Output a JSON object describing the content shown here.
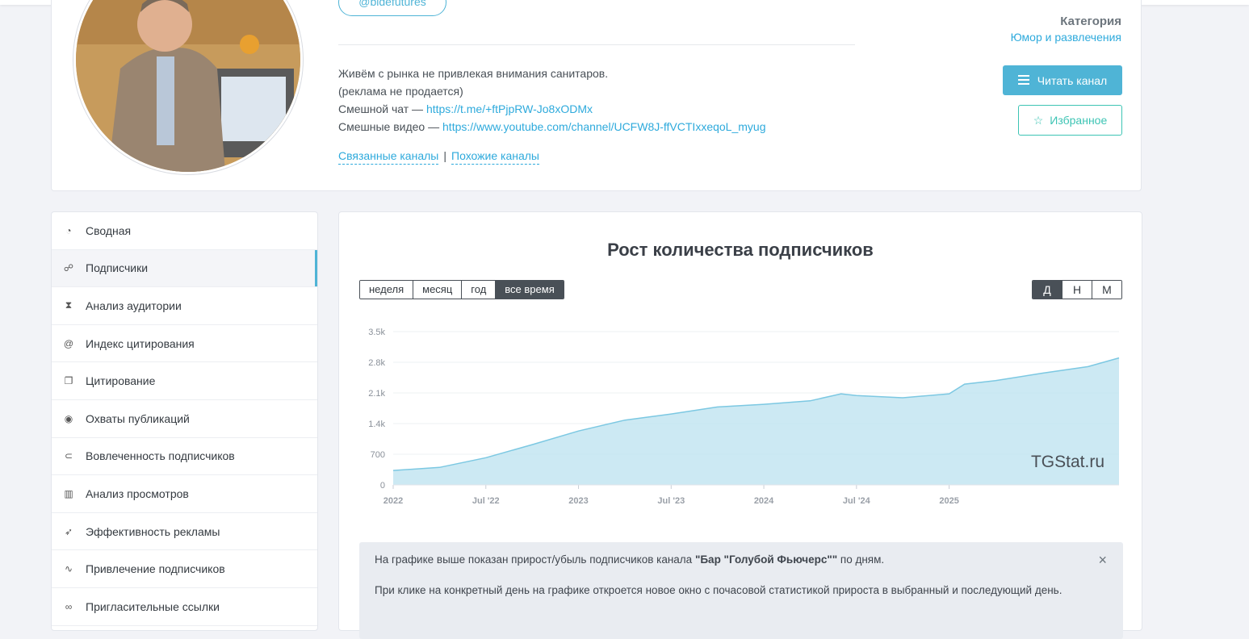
{
  "profile": {
    "username": "@bldefutures",
    "description_lines": [
      "Живём с рынка не привлекая внимания санитаров.",
      "(реклама не продается)"
    ],
    "chat_prefix": "Смешной чат — ",
    "chat_link": "https://t.me/+ftPjpRW-Jo8xODMx",
    "video_prefix": "Смешные видео — ",
    "video_link": "https://www.youtube.com/channel/UCFW8J-ffVCTIxxeqoL_myug",
    "related_channels": "Связанные каналы",
    "separator": "|",
    "similar_channels": "Похожие каналы",
    "category_label": "Категория",
    "category_value": "Юмор и развлечения",
    "read_button": "Читать канал",
    "favorite_button": "Избранное"
  },
  "sidebar": {
    "items": [
      {
        "label": "Сводная",
        "icon": "dashboard-icon"
      },
      {
        "label": "Подписчики",
        "icon": "users-icon",
        "active": true
      },
      {
        "label": "Анализ аудитории",
        "icon": "hourglass-icon"
      },
      {
        "label": "Индекс цитирования",
        "icon": "at-icon"
      },
      {
        "label": "Цитирование",
        "icon": "quote-icon"
      },
      {
        "label": "Охваты публикаций",
        "icon": "eye-icon"
      },
      {
        "label": "Вовлеченность подписчиков",
        "icon": "engagement-icon"
      },
      {
        "label": "Анализ просмотров",
        "icon": "bar-chart-icon"
      },
      {
        "label": "Эффективность рекламы",
        "icon": "rocket-icon"
      },
      {
        "label": "Привлечение подписчиков",
        "icon": "trend-icon"
      },
      {
        "label": "Пригласительные ссылки",
        "icon": "link-icon"
      }
    ]
  },
  "main": {
    "title": "Рост количества подписчиков",
    "periods": [
      "неделя",
      "месяц",
      "год",
      "все время"
    ],
    "selected_period": "все время",
    "granularity": [
      "Д",
      "Н",
      "М"
    ],
    "selected_granularity": "Д",
    "watermark": "TGStat.ru",
    "alert": {
      "line1_prefix": "На графике выше показан прирост/убыль подписчиков канала ",
      "line1_channel": "\"Бар \"Голубой Фьючерс\"\"",
      "line1_suffix": " по дням.",
      "line2": "При клике на конкретный день на графике откроется новое окно с почасовой статистикой прироста в выбранный и последующий день.",
      "close": "×"
    }
  },
  "colors": {
    "accent": "#4fb4d6",
    "favorite": "#3dc4b4",
    "area_fill": "#bfe4f0",
    "area_line": "#7cc8e2"
  },
  "chart_data": {
    "type": "area",
    "title": "Рост количества подписчиков",
    "xlabel": "",
    "ylabel": "",
    "y_ticks": [
      "0",
      "700",
      "1.4k",
      "2.1k",
      "2.8k",
      "3.5k"
    ],
    "x_ticks": [
      "2022",
      "Jul '22",
      "2023",
      "Jul '23",
      "2024",
      "Jul '24",
      "2025"
    ],
    "ylim": [
      0,
      3500
    ],
    "x": [
      "2022-01",
      "2022-04",
      "2022-07",
      "2022-10",
      "2023-01",
      "2023-04",
      "2023-07",
      "2023-10",
      "2024-01",
      "2024-04",
      "2024-06",
      "2024-07",
      "2024-10",
      "2025-01",
      "2025-02",
      "2025-04",
      "2025-07",
      "2025-10",
      "2025-12"
    ],
    "series": [
      {
        "values": [
          330,
          400,
          620,
          920,
          1230,
          1480,
          1620,
          1780,
          1840,
          1920,
          2080,
          2040,
          1990,
          2080,
          2300,
          2380,
          2550,
          2700,
          2900
        ]
      }
    ]
  }
}
